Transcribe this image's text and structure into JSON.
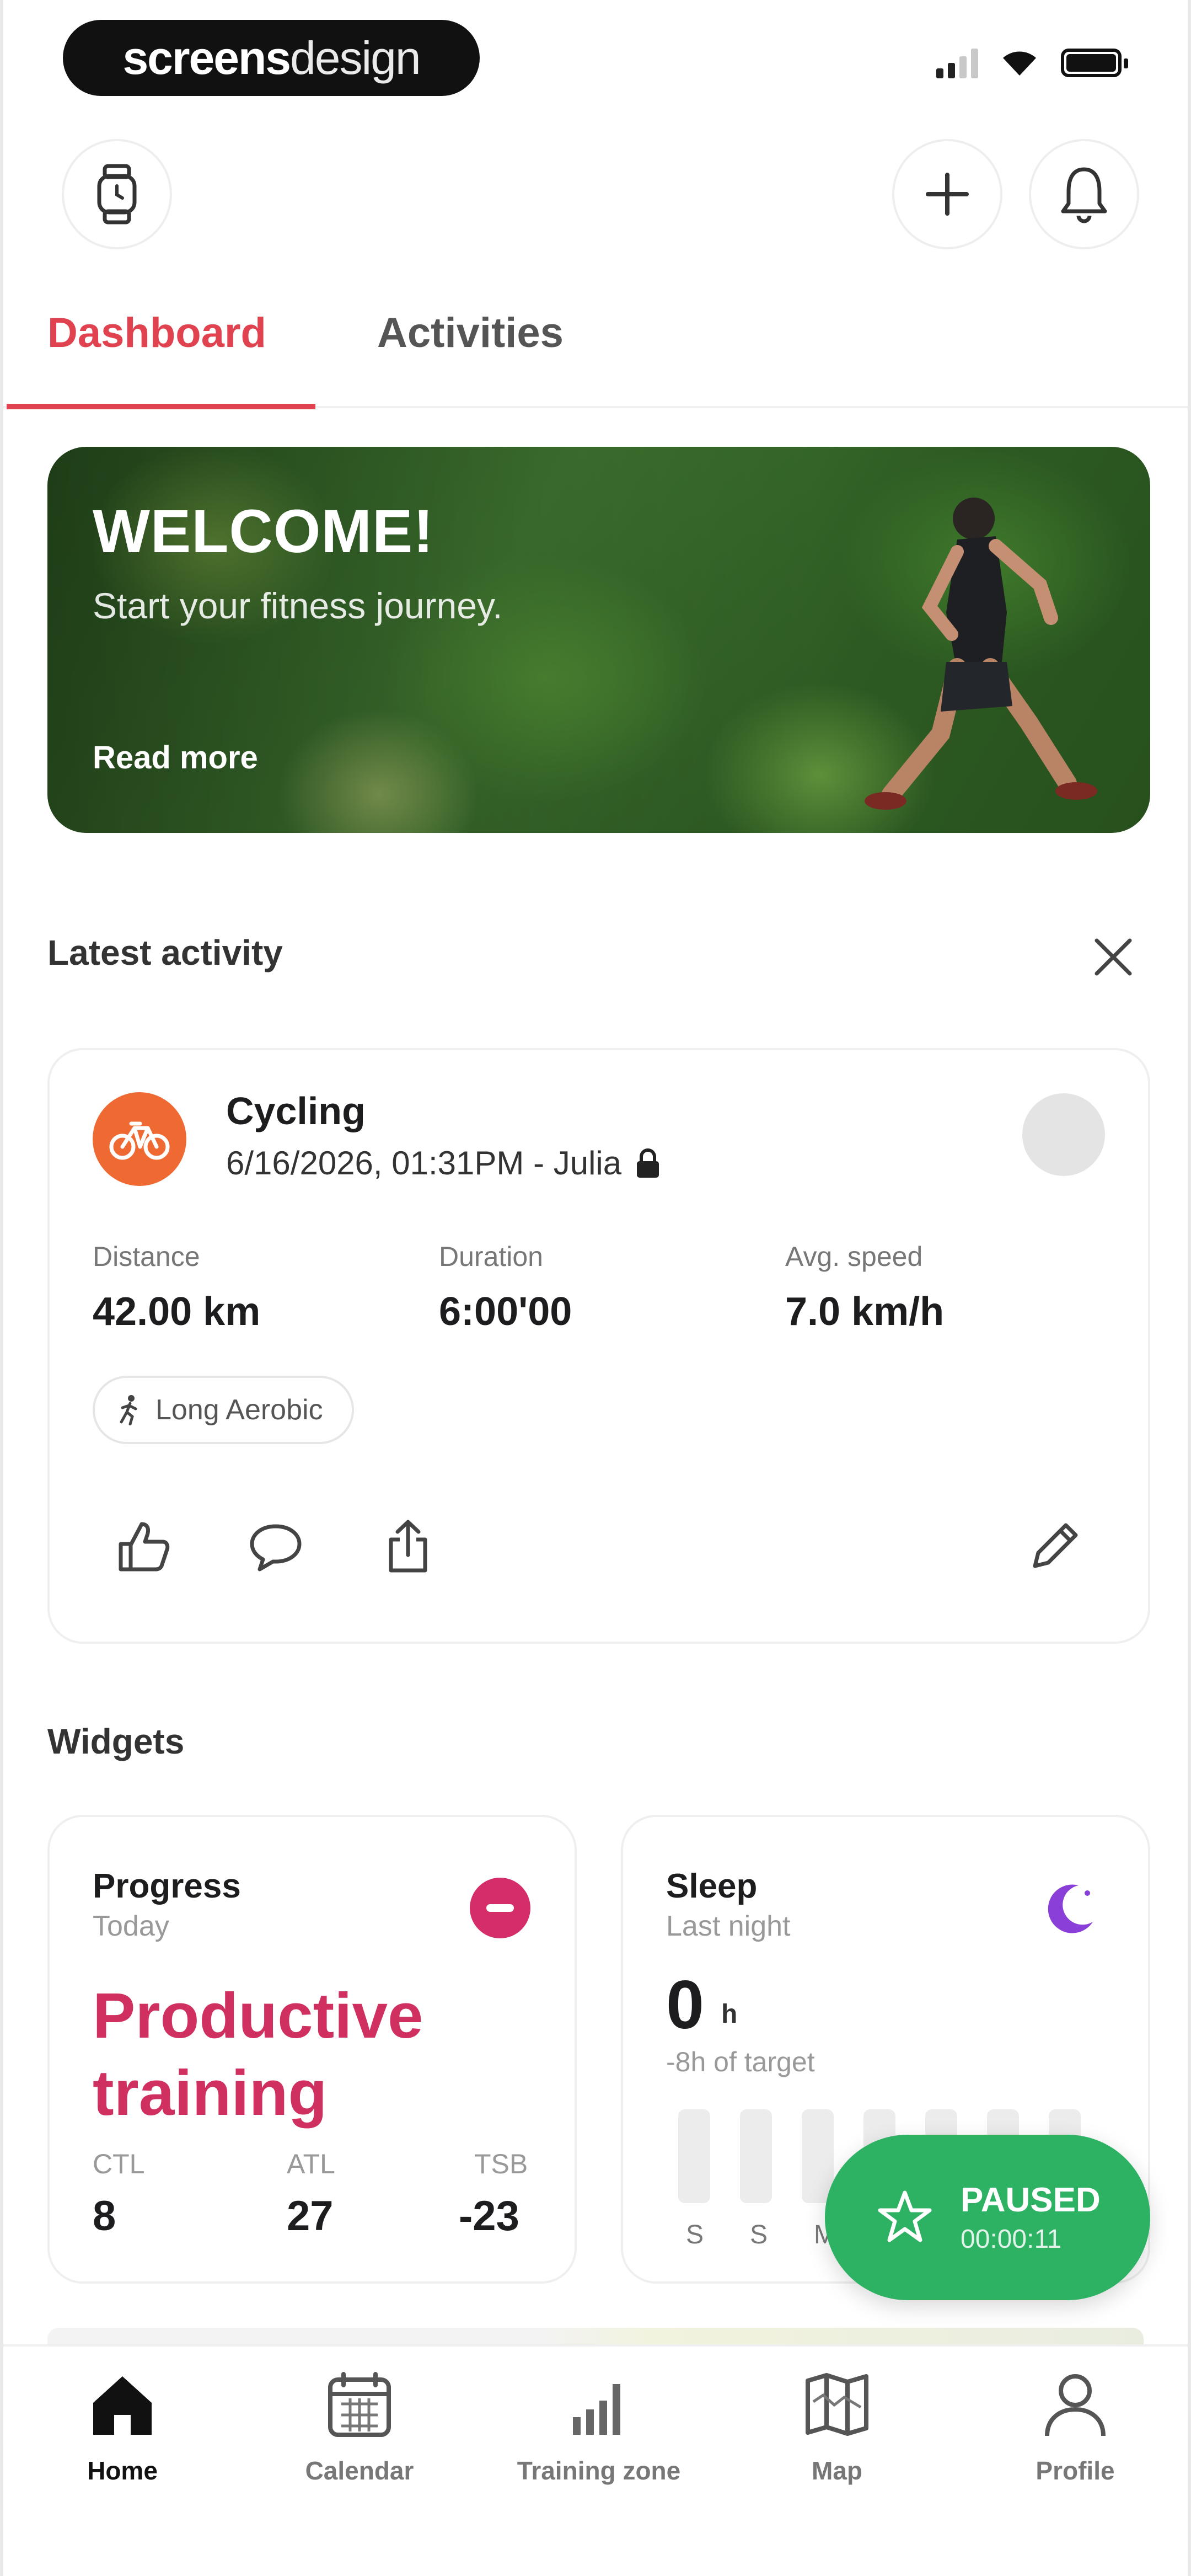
{
  "status_bar": {
    "brand_bold": "screens",
    "brand_light": "design",
    "signal_icon": "cellular-signal-icon",
    "wifi_icon": "wifi-icon",
    "battery_icon": "battery-icon"
  },
  "header": {
    "left_icon": "watch-icon",
    "add_icon": "plus-icon",
    "notification_icon": "bell-icon"
  },
  "tabs": [
    {
      "label": "Dashboard",
      "active": true
    },
    {
      "label": "Activities",
      "active": false
    }
  ],
  "hero": {
    "title": "WELCOME!",
    "subtitle": "Start your fitness journey.",
    "link": "Read more"
  },
  "latest_activity": {
    "section_title": "Latest activity",
    "close_icon": "close-icon",
    "sport_icon": "bicycle-icon",
    "title": "Cycling",
    "meta": "6/16/2026, 01:31PM - Julia",
    "privacy_icon": "lock-icon",
    "stats": [
      {
        "label": "Distance",
        "value": "42.00 km"
      },
      {
        "label": "Duration",
        "value": "6:00'00"
      },
      {
        "label": "Avg. speed",
        "value": "7.0 km/h"
      }
    ],
    "tag": "Long Aerobic",
    "actions": [
      "thumbs-up-icon",
      "comment-icon",
      "share-icon",
      "edit-icon"
    ]
  },
  "widgets": {
    "section_title": "Widgets",
    "progress": {
      "title": "Progress",
      "subtitle": "Today",
      "headline_line1": "Productive",
      "headline_line2": "training",
      "metrics": [
        {
          "label": "CTL",
          "value": "8"
        },
        {
          "label": "ATL",
          "value": "27"
        },
        {
          "label": "TSB",
          "value": "-23"
        }
      ],
      "accent": "#d0305f"
    },
    "sleep": {
      "title": "Sleep",
      "subtitle": "Last night",
      "icon": "moon-icon",
      "value": "0",
      "unit": "h",
      "target": "-8h of target",
      "days": [
        "S",
        "S",
        "M"
      ]
    }
  },
  "paused_button": {
    "status": "PAUSED",
    "timer": "00:00:11",
    "icon": "star-icon",
    "color": "#2db163"
  },
  "bottom_nav": [
    {
      "label": "Home",
      "icon": "home-icon",
      "active": true
    },
    {
      "label": "Calendar",
      "icon": "calendar-icon",
      "active": false
    },
    {
      "label": "Training zone",
      "icon": "bar-chart-icon",
      "active": false
    },
    {
      "label": "Map",
      "icon": "map-icon",
      "active": false
    },
    {
      "label": "Profile",
      "icon": "person-icon",
      "active": false
    }
  ],
  "colors": {
    "accent_red": "#e0434f",
    "cycling_orange": "#ef6a33",
    "progress_pink": "#d52d6a",
    "sleep_purple": "#8a3fd8"
  }
}
